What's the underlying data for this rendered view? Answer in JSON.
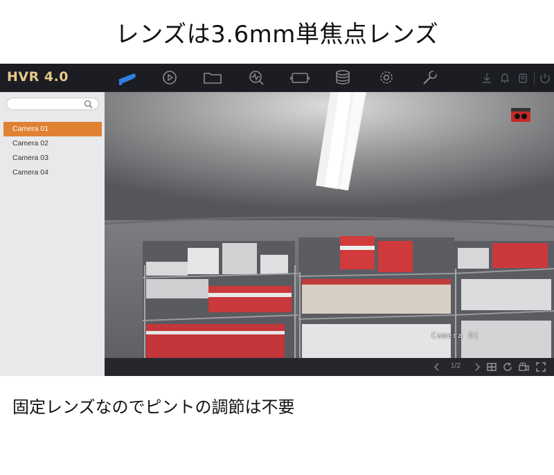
{
  "headline": "レンズは3.6mm単焦点レンズ",
  "caption": "固定レンズなのでピントの調節は不要",
  "app": {
    "brand": "HVR 4.0",
    "accent_color": "#e08134",
    "nav_icons": [
      "live-view-camera-icon",
      "playback-icon",
      "file-folder-icon",
      "smart-analysis-icon",
      "camera-management-icon",
      "storage-disk-icon",
      "settings-gear-icon",
      "maintenance-wrench-icon"
    ],
    "system_icons": [
      "download-icon",
      "alarm-bell-icon",
      "account-icon",
      "power-icon"
    ],
    "search": {
      "placeholder": ""
    },
    "cameras": [
      "Camera 01",
      "Camera 02",
      "Camera 03",
      "Camera 04"
    ],
    "selected_camera": "Camera 01",
    "osd_label": "Camera 01",
    "pagination": "1/2"
  }
}
